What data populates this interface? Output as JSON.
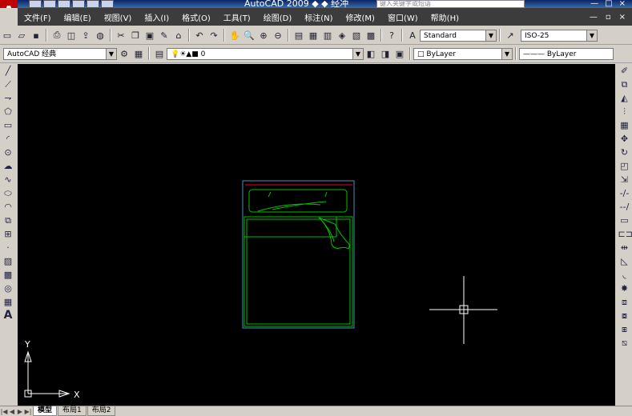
{
  "titlebar": {
    "title": "AutoCAD 2009 ◆ ◆ 经冲",
    "search_placeholder": "键入关键字或短语",
    "app_icon": "A",
    "minimize": "—",
    "maximize": "□",
    "close": "×"
  },
  "menu": {
    "items": [
      "文件(F)",
      "编辑(E)",
      "视图(V)",
      "插入(I)",
      "格式(O)",
      "工具(T)",
      "绘图(D)",
      "标注(N)",
      "修改(M)",
      "窗口(W)",
      "帮助(H)"
    ],
    "doc_minimize": "—",
    "doc_restore": "▫",
    "doc_close": "×"
  },
  "toolbar1": {
    "text_style": "Standard",
    "dim_style": "ISO-25",
    "text_style_icon": "A",
    "dim_style_icon": "↗"
  },
  "toolbar2": {
    "workspace": "AutoCAD 经典",
    "layer": "0",
    "color": "ByLayer",
    "linetype": "——— ByLayer"
  },
  "ucs": {
    "x_label": "X",
    "y_label": "Y"
  },
  "tabs": [
    "模型",
    "布局1",
    "布局2"
  ],
  "colors": {
    "canvas": "#000000",
    "bed_outline": "#00c000",
    "frame_outline": "#4a90c0",
    "headboard_line": "#c00020",
    "crosshair": "#ffffff"
  }
}
